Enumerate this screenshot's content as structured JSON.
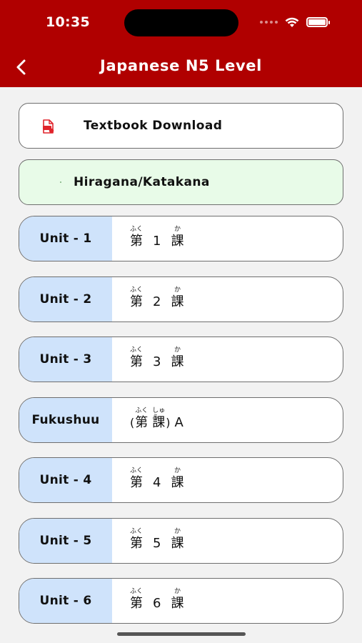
{
  "status_bar": {
    "time": "10:35"
  },
  "nav": {
    "title": "Japanese N5 Level"
  },
  "items": {
    "textbook": {
      "label": "Textbook Download",
      "icon": "pdf-file-icon"
    },
    "hiragana": {
      "label": "Hiragana/Katakana"
    }
  },
  "units": [
    {
      "tag": "Unit - 1",
      "furi_first": "ふく",
      "kanji_first": "第",
      "number": "1",
      "furi_last": "か",
      "kanji_last": "課"
    },
    {
      "tag": "Unit - 2",
      "furi_first": "ふく",
      "kanji_first": "第",
      "number": "2",
      "furi_last": "か",
      "kanji_last": "課"
    },
    {
      "tag": "Unit - 3",
      "furi_first": "ふく",
      "kanji_first": "第",
      "number": "3",
      "furi_last": "か",
      "kanji_last": "課"
    },
    {
      "tag": "Fukushuu",
      "furi_first": "ふく",
      "kanji_first": "第",
      "furi_last": "しゅう",
      "kanji_last": "課",
      "open": "(",
      "close": ")",
      "suffix": "A"
    },
    {
      "tag": "Unit - 4",
      "furi_first": "ふく",
      "kanji_first": "第",
      "number": "4",
      "furi_last": "か",
      "kanji_last": "課"
    },
    {
      "tag": "Unit - 5",
      "furi_first": "ふく",
      "kanji_first": "第",
      "number": "5",
      "furi_last": "か",
      "kanji_last": "課"
    },
    {
      "tag": "Unit - 6",
      "furi_first": "ふく",
      "kanji_first": "第",
      "number": "6",
      "furi_last": "か",
      "kanji_last": "課"
    }
  ],
  "colors": {
    "header": "#b00000",
    "unit_tag": "#cfe3fb",
    "hiragana_bg": "#e8fbe8"
  }
}
